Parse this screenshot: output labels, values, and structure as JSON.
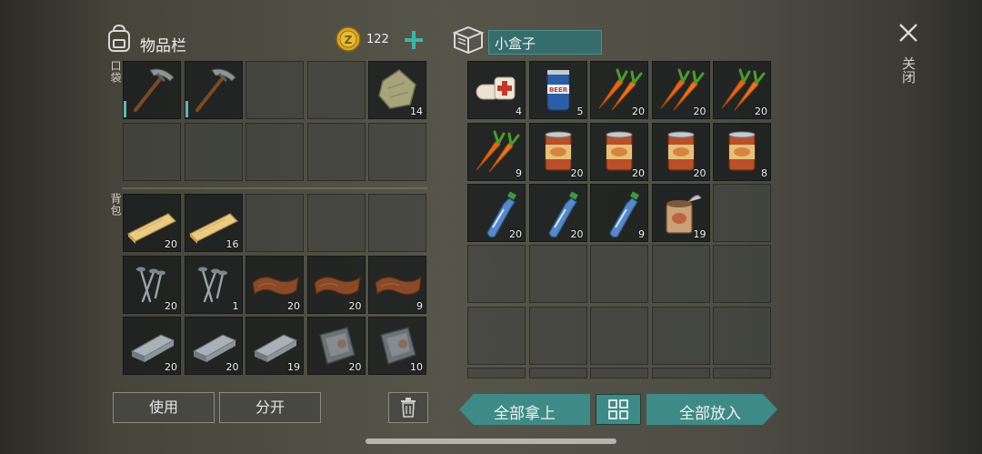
{
  "inventory": {
    "title": "物品栏",
    "coins": "122",
    "pocket_label": "口袋",
    "backpack_label": "背包",
    "pocket_slots": [
      {
        "item": "pickaxe-icon",
        "count": ""
      },
      {
        "item": "pickaxe-icon",
        "count": ""
      },
      {
        "item": "",
        "count": ""
      },
      {
        "item": "",
        "count": ""
      },
      {
        "item": "cloth-icon",
        "count": "14"
      },
      {
        "item": "",
        "count": ""
      },
      {
        "item": "",
        "count": ""
      },
      {
        "item": "",
        "count": ""
      },
      {
        "item": "",
        "count": ""
      },
      {
        "item": "",
        "count": ""
      }
    ],
    "backpack_slots": [
      {
        "item": "wood-plank-icon",
        "count": "20"
      },
      {
        "item": "wood-plank-icon",
        "count": "16"
      },
      {
        "item": "",
        "count": ""
      },
      {
        "item": "",
        "count": ""
      },
      {
        "item": "",
        "count": ""
      },
      {
        "item": "nails-icon",
        "count": "20"
      },
      {
        "item": "nails-icon",
        "count": "1"
      },
      {
        "item": "leather-icon",
        "count": "20"
      },
      {
        "item": "leather-icon",
        "count": "20"
      },
      {
        "item": "leather-icon",
        "count": "9"
      },
      {
        "item": "iron-bar-icon",
        "count": "20"
      },
      {
        "item": "iron-bar-icon",
        "count": "20"
      },
      {
        "item": "iron-bar-icon",
        "count": "19"
      },
      {
        "item": "metal-plate-icon",
        "count": "20"
      },
      {
        "item": "metal-plate-icon",
        "count": "10"
      }
    ],
    "use_button": "使用",
    "split_button": "分开"
  },
  "container": {
    "name": "小盒子",
    "slots": [
      {
        "item": "bandage-icon",
        "count": "4"
      },
      {
        "item": "beer-can-icon",
        "count": "5"
      },
      {
        "item": "carrot-icon",
        "count": "20"
      },
      {
        "item": "carrot-icon",
        "count": "20"
      },
      {
        "item": "carrot-icon",
        "count": "20"
      },
      {
        "item": "carrot-icon",
        "count": "9"
      },
      {
        "item": "canned-food-icon",
        "count": "20"
      },
      {
        "item": "canned-food-icon",
        "count": "20"
      },
      {
        "item": "canned-food-icon",
        "count": "20"
      },
      {
        "item": "canned-food-icon",
        "count": "8"
      },
      {
        "item": "water-bottle-icon",
        "count": "20"
      },
      {
        "item": "water-bottle-icon",
        "count": "20"
      },
      {
        "item": "water-bottle-icon",
        "count": "9"
      },
      {
        "item": "open-can-icon",
        "count": "19"
      },
      {
        "item": "",
        "count": ""
      }
    ],
    "take_all_button": "全部拿上",
    "put_all_button": "全部放入"
  },
  "close_label": "关闭",
  "colors": {
    "accent": "#3e8a86",
    "name_box": "#356d6d",
    "coin": "#d9a723"
  }
}
